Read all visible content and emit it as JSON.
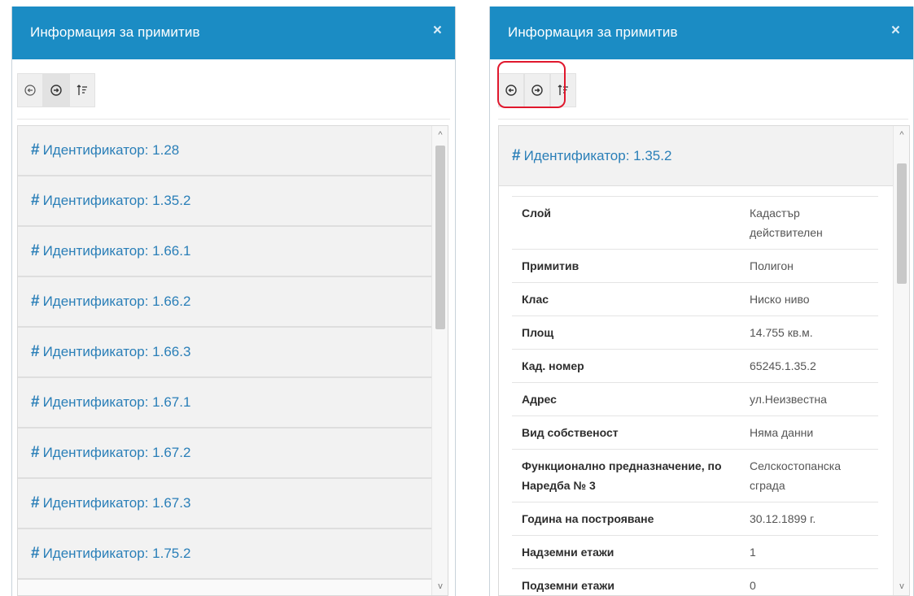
{
  "left_panel": {
    "title": "Информация за примитив",
    "close": "×",
    "toolbar": [
      {
        "icon": "arrow-left-circle-icon"
      },
      {
        "icon": "arrow-right-circle-icon"
      },
      {
        "icon": "sort-icon"
      }
    ],
    "items": [
      {
        "hash": "#",
        "label": "Идентификатор: 1.28"
      },
      {
        "hash": "#",
        "label": "Идентификатор: 1.35.2"
      },
      {
        "hash": "#",
        "label": "Идентификатор: 1.66.1"
      },
      {
        "hash": "#",
        "label": "Идентификатор: 1.66.2"
      },
      {
        "hash": "#",
        "label": "Идентификатор: 1.66.3"
      },
      {
        "hash": "#",
        "label": "Идентификатор: 1.67.1"
      },
      {
        "hash": "#",
        "label": "Идентификатор: 1.67.2"
      },
      {
        "hash": "#",
        "label": "Идентификатор: 1.67.3"
      },
      {
        "hash": "#",
        "label": "Идентификатор: 1.75.2"
      }
    ],
    "scroll_up": "^",
    "scroll_down": "v"
  },
  "right_panel": {
    "title": "Информация за примитив",
    "close": "×",
    "detail_hash": "#",
    "detail_title": "Идентификатор: 1.35.2",
    "properties": [
      {
        "key": "Слой",
        "value": "Кадастър действителен"
      },
      {
        "key": "Примитив",
        "value": "Полигон"
      },
      {
        "key": "Клас",
        "value": "Ниско ниво"
      },
      {
        "key": "Площ",
        "value": "14.755 кв.м."
      },
      {
        "key": "Кад. номер",
        "value": "65245.1.35.2"
      },
      {
        "key": "Адрес",
        "value": "ул.Неизвестна"
      },
      {
        "key": "Вид собственост",
        "value": "Няма данни"
      },
      {
        "key": "Функционално предназначение, по Наредба № 3",
        "value": "Селскостопанска сграда"
      },
      {
        "key": "Година на построяване",
        "value": "30.12.1899 г."
      },
      {
        "key": "Надземни етажи",
        "value": "1"
      },
      {
        "key": "Подземни етажи",
        "value": "0"
      }
    ],
    "scroll_up": "^",
    "scroll_down": "v"
  },
  "colors": {
    "header": "#1b8cc4",
    "link": "#2a7fb8",
    "highlight": "#e0182d"
  }
}
